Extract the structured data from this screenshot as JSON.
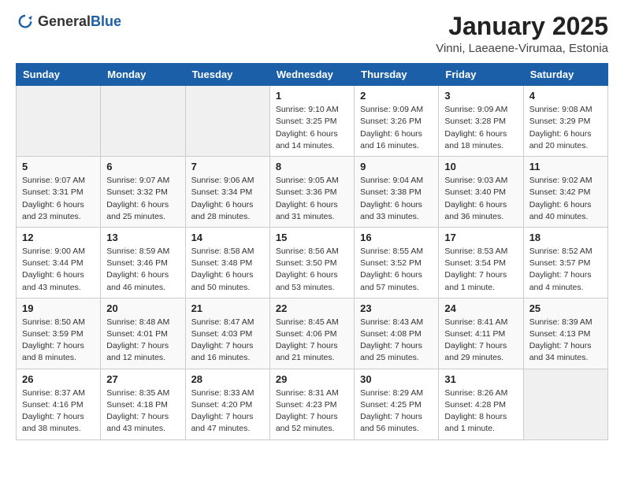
{
  "logo": {
    "general": "General",
    "blue": "Blue"
  },
  "title": "January 2025",
  "subtitle": "Vinni, Laeaene-Virumaa, Estonia",
  "days_of_week": [
    "Sunday",
    "Monday",
    "Tuesday",
    "Wednesday",
    "Thursday",
    "Friday",
    "Saturday"
  ],
  "weeks": [
    [
      {
        "day": "",
        "info": ""
      },
      {
        "day": "",
        "info": ""
      },
      {
        "day": "",
        "info": ""
      },
      {
        "day": "1",
        "info": "Sunrise: 9:10 AM\nSunset: 3:25 PM\nDaylight: 6 hours\nand 14 minutes."
      },
      {
        "day": "2",
        "info": "Sunrise: 9:09 AM\nSunset: 3:26 PM\nDaylight: 6 hours\nand 16 minutes."
      },
      {
        "day": "3",
        "info": "Sunrise: 9:09 AM\nSunset: 3:28 PM\nDaylight: 6 hours\nand 18 minutes."
      },
      {
        "day": "4",
        "info": "Sunrise: 9:08 AM\nSunset: 3:29 PM\nDaylight: 6 hours\nand 20 minutes."
      }
    ],
    [
      {
        "day": "5",
        "info": "Sunrise: 9:07 AM\nSunset: 3:31 PM\nDaylight: 6 hours\nand 23 minutes."
      },
      {
        "day": "6",
        "info": "Sunrise: 9:07 AM\nSunset: 3:32 PM\nDaylight: 6 hours\nand 25 minutes."
      },
      {
        "day": "7",
        "info": "Sunrise: 9:06 AM\nSunset: 3:34 PM\nDaylight: 6 hours\nand 28 minutes."
      },
      {
        "day": "8",
        "info": "Sunrise: 9:05 AM\nSunset: 3:36 PM\nDaylight: 6 hours\nand 31 minutes."
      },
      {
        "day": "9",
        "info": "Sunrise: 9:04 AM\nSunset: 3:38 PM\nDaylight: 6 hours\nand 33 minutes."
      },
      {
        "day": "10",
        "info": "Sunrise: 9:03 AM\nSunset: 3:40 PM\nDaylight: 6 hours\nand 36 minutes."
      },
      {
        "day": "11",
        "info": "Sunrise: 9:02 AM\nSunset: 3:42 PM\nDaylight: 6 hours\nand 40 minutes."
      }
    ],
    [
      {
        "day": "12",
        "info": "Sunrise: 9:00 AM\nSunset: 3:44 PM\nDaylight: 6 hours\nand 43 minutes."
      },
      {
        "day": "13",
        "info": "Sunrise: 8:59 AM\nSunset: 3:46 PM\nDaylight: 6 hours\nand 46 minutes."
      },
      {
        "day": "14",
        "info": "Sunrise: 8:58 AM\nSunset: 3:48 PM\nDaylight: 6 hours\nand 50 minutes."
      },
      {
        "day": "15",
        "info": "Sunrise: 8:56 AM\nSunset: 3:50 PM\nDaylight: 6 hours\nand 53 minutes."
      },
      {
        "day": "16",
        "info": "Sunrise: 8:55 AM\nSunset: 3:52 PM\nDaylight: 6 hours\nand 57 minutes."
      },
      {
        "day": "17",
        "info": "Sunrise: 8:53 AM\nSunset: 3:54 PM\nDaylight: 7 hours\nand 1 minute."
      },
      {
        "day": "18",
        "info": "Sunrise: 8:52 AM\nSunset: 3:57 PM\nDaylight: 7 hours\nand 4 minutes."
      }
    ],
    [
      {
        "day": "19",
        "info": "Sunrise: 8:50 AM\nSunset: 3:59 PM\nDaylight: 7 hours\nand 8 minutes."
      },
      {
        "day": "20",
        "info": "Sunrise: 8:48 AM\nSunset: 4:01 PM\nDaylight: 7 hours\nand 12 minutes."
      },
      {
        "day": "21",
        "info": "Sunrise: 8:47 AM\nSunset: 4:03 PM\nDaylight: 7 hours\nand 16 minutes."
      },
      {
        "day": "22",
        "info": "Sunrise: 8:45 AM\nSunset: 4:06 PM\nDaylight: 7 hours\nand 21 minutes."
      },
      {
        "day": "23",
        "info": "Sunrise: 8:43 AM\nSunset: 4:08 PM\nDaylight: 7 hours\nand 25 minutes."
      },
      {
        "day": "24",
        "info": "Sunrise: 8:41 AM\nSunset: 4:11 PM\nDaylight: 7 hours\nand 29 minutes."
      },
      {
        "day": "25",
        "info": "Sunrise: 8:39 AM\nSunset: 4:13 PM\nDaylight: 7 hours\nand 34 minutes."
      }
    ],
    [
      {
        "day": "26",
        "info": "Sunrise: 8:37 AM\nSunset: 4:16 PM\nDaylight: 7 hours\nand 38 minutes."
      },
      {
        "day": "27",
        "info": "Sunrise: 8:35 AM\nSunset: 4:18 PM\nDaylight: 7 hours\nand 43 minutes."
      },
      {
        "day": "28",
        "info": "Sunrise: 8:33 AM\nSunset: 4:20 PM\nDaylight: 7 hours\nand 47 minutes."
      },
      {
        "day": "29",
        "info": "Sunrise: 8:31 AM\nSunset: 4:23 PM\nDaylight: 7 hours\nand 52 minutes."
      },
      {
        "day": "30",
        "info": "Sunrise: 8:29 AM\nSunset: 4:25 PM\nDaylight: 7 hours\nand 56 minutes."
      },
      {
        "day": "31",
        "info": "Sunrise: 8:26 AM\nSunset: 4:28 PM\nDaylight: 8 hours\nand 1 minute."
      },
      {
        "day": "",
        "info": ""
      }
    ]
  ]
}
